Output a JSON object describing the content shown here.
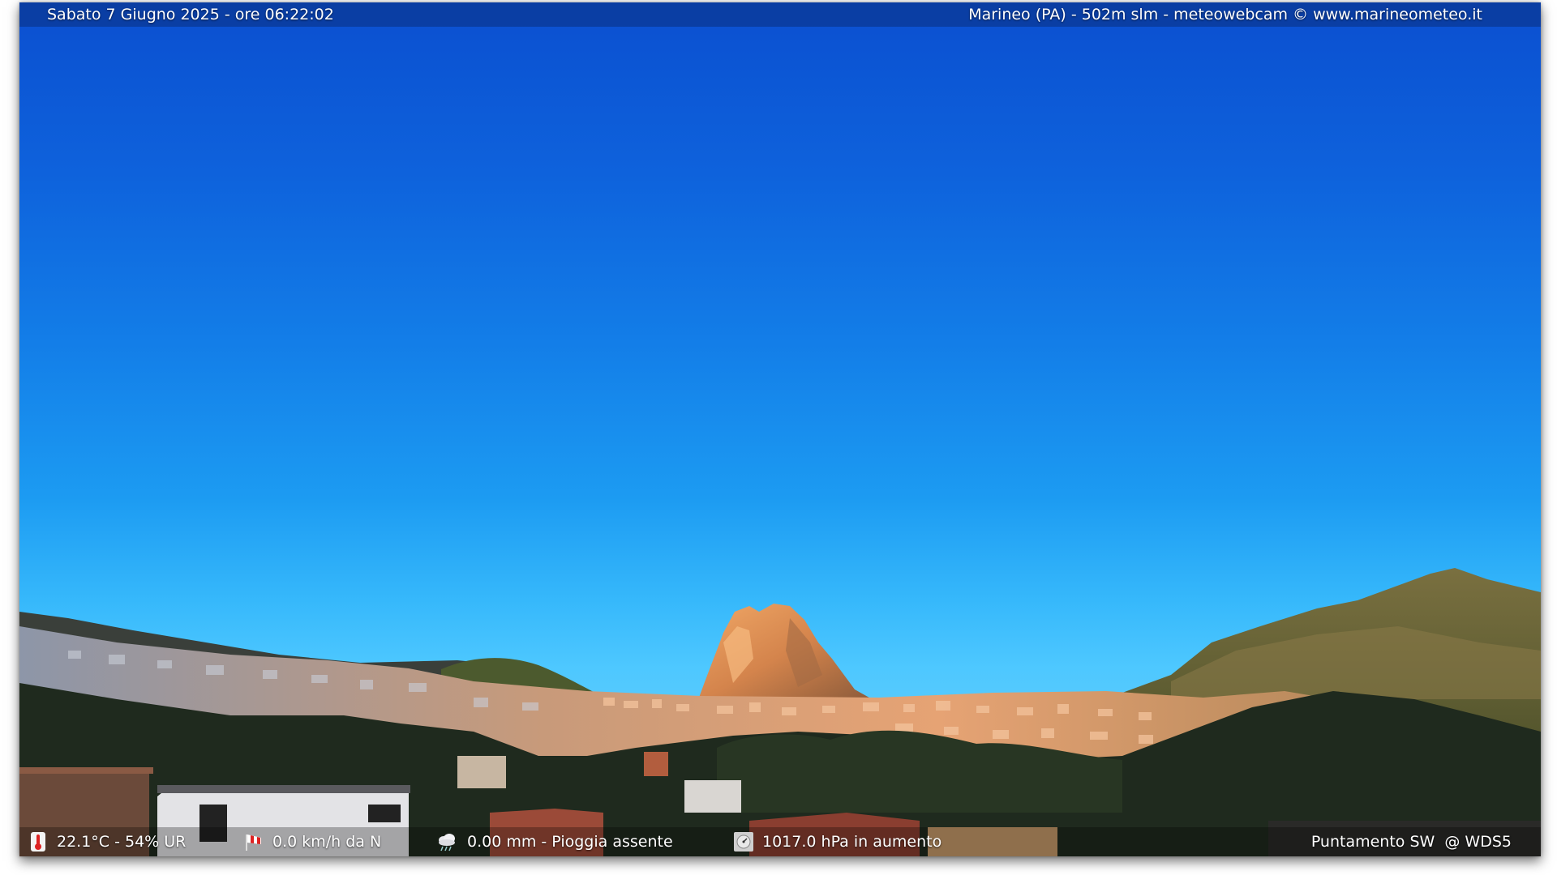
{
  "header": {
    "datetime": "Sabato 7 Giugno 2025 - ore 06:22:02",
    "station_info": "Marineo (PA) - 502m slm - meteowebcam © www.marineometeo.it"
  },
  "footer": {
    "temperature_humidity": "22.1°C - 54% UR",
    "wind": "0.0 km/h da N",
    "rain": "0.00 mm - Pioggia assente",
    "pressure": "1017.0 hPa in aumento",
    "camera_direction": "Puntamento SW  @ WDS5"
  },
  "icons": {
    "temperature": "thermometer-icon",
    "wind": "windsock-icon",
    "rain": "rain-cloud-icon",
    "pressure": "barometer-icon"
  },
  "colors": {
    "sky_top": "#0b4fd0",
    "sky_horizon": "#5ccbfb",
    "rock_lit": "#d98a4e",
    "town_lit": "#e0a27a"
  }
}
